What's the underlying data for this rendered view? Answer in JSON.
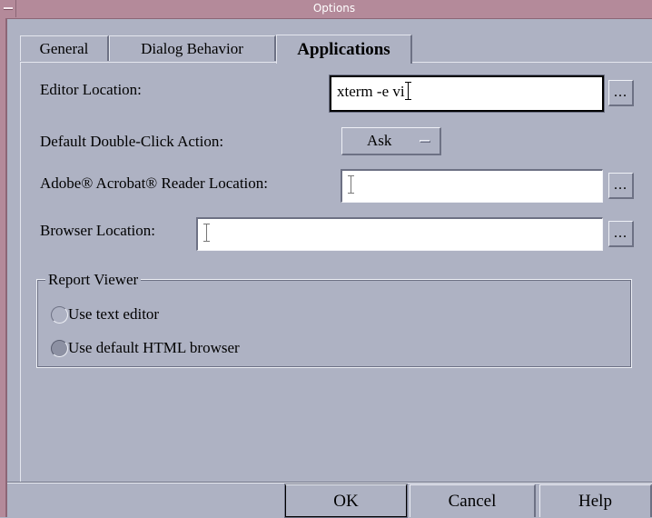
{
  "window": {
    "title": "Options"
  },
  "tabs": [
    {
      "label": "General"
    },
    {
      "label": "Dialog Behavior"
    },
    {
      "label": "Applications"
    }
  ],
  "applications": {
    "editor_location": {
      "label": "Editor Location:",
      "value": "xterm -e vi",
      "browse": "..."
    },
    "double_click": {
      "label": "Default Double-Click Action:",
      "value": "Ask"
    },
    "acrobat": {
      "label": "Adobe® Acrobat® Reader Location:",
      "value": "",
      "browse": "..."
    },
    "browser": {
      "label": "Browser Location:",
      "value": "",
      "browse": "..."
    },
    "report_viewer": {
      "legend": "Report Viewer",
      "options": [
        {
          "label": "Use text editor",
          "checked": false
        },
        {
          "label": "Use default HTML browser",
          "checked": true
        }
      ]
    }
  },
  "buttons": {
    "ok": "OK",
    "cancel": "Cancel",
    "help": "Help"
  },
  "colors": {
    "titlebar": "#b48a9a",
    "background": "#aeb2c3"
  }
}
